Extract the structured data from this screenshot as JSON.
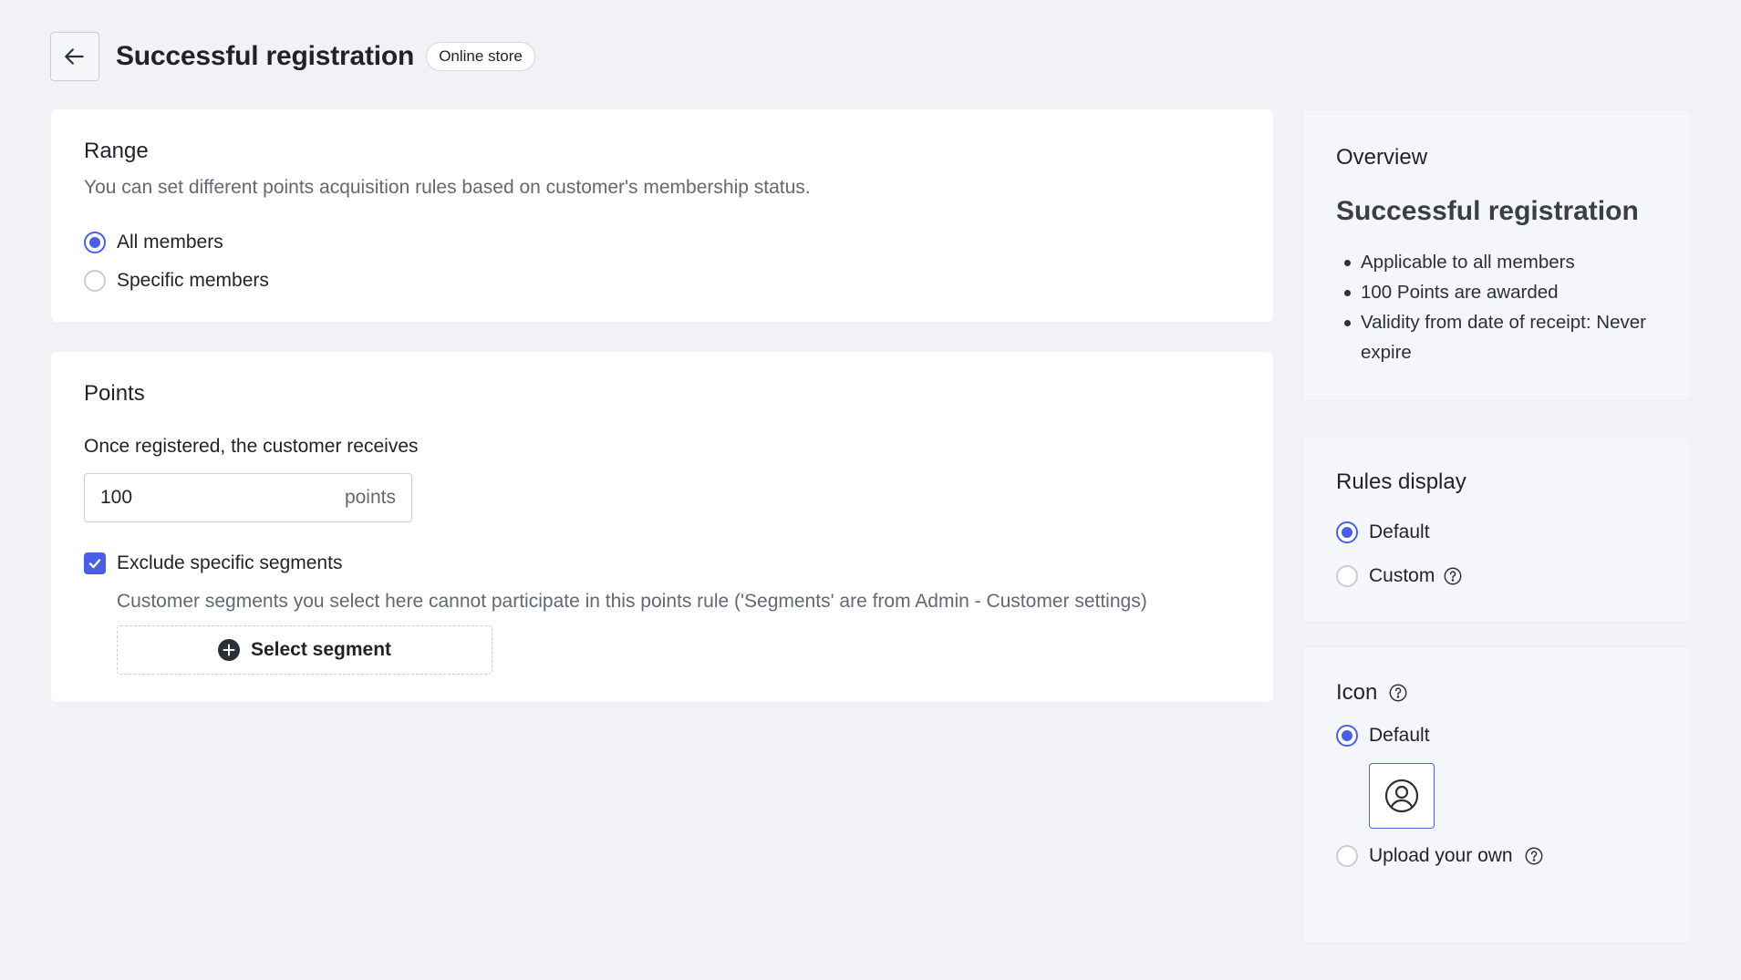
{
  "header": {
    "title": "Successful registration",
    "badge": "Online store"
  },
  "range": {
    "heading": "Range",
    "description": "You can set different points acquisition rules based on customer's membership status.",
    "options": [
      {
        "label": "All members",
        "checked": true
      },
      {
        "label": "Specific members",
        "checked": false
      }
    ]
  },
  "points": {
    "heading": "Points",
    "input_label": "Once registered, the customer receives",
    "value": "100",
    "suffix": "points",
    "exclude_label": "Exclude specific segments",
    "exclude_checked": true,
    "exclude_description": "Customer segments you select here cannot participate in this points rule ('Segments' are from Admin - Customer settings)",
    "select_segment_label": "Select segment"
  },
  "overview": {
    "heading": "Overview",
    "title": "Successful registration",
    "items": [
      "Applicable to all members",
      "100 Points are awarded",
      "Validity from date of receipt: Never expire"
    ]
  },
  "rules_display": {
    "heading": "Rules display",
    "options": [
      {
        "label": "Default",
        "checked": true
      },
      {
        "label": "Custom",
        "checked": false
      }
    ]
  },
  "icon_section": {
    "heading": "Icon",
    "options": [
      {
        "label": "Default",
        "checked": true
      },
      {
        "label": "Upload your own",
        "checked": false
      }
    ]
  },
  "colors": {
    "accent": "#4a5ee6",
    "background": "#f1f2f5"
  },
  "icons": {
    "back": "arrow-left-icon",
    "help": "question-circle-icon",
    "add": "plus-circle-icon",
    "default_icon": "user-circle-icon",
    "check": "check-icon"
  }
}
